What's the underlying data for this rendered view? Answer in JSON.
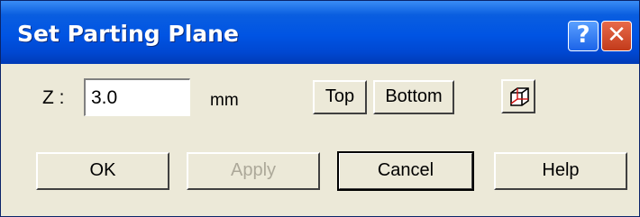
{
  "window": {
    "title": "Set Parting Plane",
    "help_label": "?",
    "close_label": "✕"
  },
  "z": {
    "label": "Z :",
    "value": "3.0",
    "unit": "mm"
  },
  "buttons": {
    "top": "Top",
    "bottom": "Bottom",
    "view_icon": "cube-view-icon",
    "ok": "OK",
    "apply": "Apply",
    "cancel": "Cancel",
    "help": "Help"
  },
  "colors": {
    "titlebar": "#0054e3",
    "face": "#ece9d8",
    "close": "#c23b1b",
    "disabled_text": "#aca899"
  }
}
